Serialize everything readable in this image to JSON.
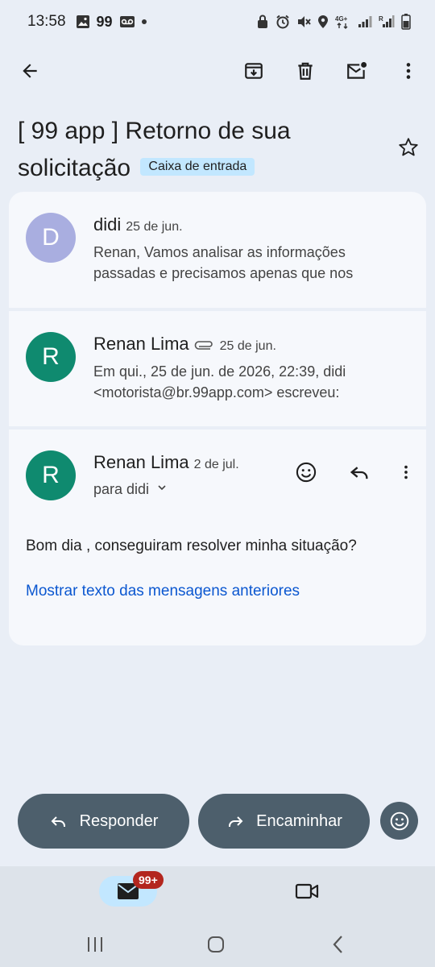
{
  "status_bar": {
    "time": "13:58",
    "notif_99": "99"
  },
  "email": {
    "subject": "[ 99 app ] Retorno de sua solicitação",
    "label": "Caixa de entrada"
  },
  "messages": [
    {
      "avatar": "D",
      "sender": "didi",
      "date": "25 de jun.",
      "snippet": "Renan, Vamos analisar as informações passadas e precisamos apenas que nos"
    },
    {
      "avatar": "R",
      "sender": "Renan Lima",
      "date": "25 de jun.",
      "snippet": "Em qui., 25 de jun. de 2026, 22:39, didi <motorista@br.99app.com> escreveu:"
    },
    {
      "avatar": "R",
      "sender": "Renan Lima",
      "date": "2 de jul.",
      "recipient": "para didi",
      "body": "Bom dia , conseguiram resolver minha situação?",
      "show_quoted": "Mostrar texto das mensagens anteriores"
    }
  ],
  "actions": {
    "reply": "Responder",
    "forward": "Encaminhar"
  },
  "nav": {
    "mail_badge": "99+"
  },
  "colors": {
    "background": "#e9eef6",
    "card": "#f6f8fc",
    "avatar_d": "#a9aee0",
    "avatar_r": "#0f8a6f",
    "pill": "#4d5f6c",
    "link": "#0b57d0",
    "label_chip": "#c2e7ff",
    "badge": "#b3261e"
  },
  "icons": [
    "back-arrow-icon",
    "archive-icon",
    "trash-icon",
    "mark-unread-icon",
    "more-vert-icon",
    "star-icon",
    "attachment-icon",
    "emoji-icon",
    "reply-icon",
    "forward-icon",
    "mail-icon",
    "video-icon"
  ]
}
